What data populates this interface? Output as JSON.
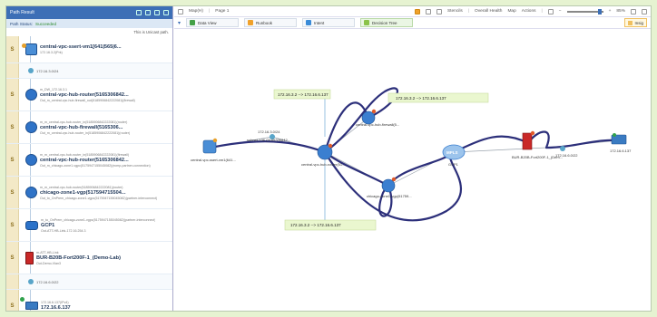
{
  "left_panel": {
    "title": "Path Result",
    "status_label": "Path Status:",
    "status_value": "Succeeded",
    "note": "This is Unicast path.",
    "hops": [
      {
        "index": "S",
        "kind": "device",
        "icon": "vpc-icon",
        "top": "",
        "name": "central-vpc-ssert-vm1[641|565|6...",
        "sub": "172.16.3.2(Prk)"
      },
      {
        "index": "",
        "kind": "link",
        "iface": "172.16.3.0/24"
      },
      {
        "index": "S",
        "kind": "device",
        "icon": "router-icon",
        "top": "m_DW_172.16.3.1",
        "name": "central-vpc-hub-router(5165306842...",
        "sub": "Out_m_central-vpc-hub-firewall_out(5185906842222081)(firewall)"
      },
      {
        "index": "S",
        "kind": "device",
        "icon": "router-icon",
        "top": "m_m_central-vpc-hub-router_in(5185906842222081)(router)",
        "name": "central-vpc-hub-firewall(5165306...",
        "sub": "Out_m_central-vpc-hub-router_in(5185906842222081)(router)"
      },
      {
        "index": "S",
        "kind": "device",
        "icon": "router-icon",
        "top": "m_m_central-vpc-hub-router_in(5185906842222081)(firewall)",
        "name": "central-vpc-hub-router(5165306842...",
        "sub": "Out_m_chicago-zone1-vgpc(5175947155045082)(ecmp-partner-connection)"
      },
      {
        "index": "S",
        "kind": "device",
        "icon": "router-icon",
        "top": "m_m_central-vpc-hub-router(5185906842222081)(router)",
        "name": "chicago-zone1-vgp(517594715504...",
        "sub": "Out_to_OnPrem_chicago-zone1-vgpc(5175947155045082)(partner-interconnect)"
      },
      {
        "index": "S",
        "kind": "device",
        "icon": "gcp-icon",
        "top": "m_to_OnPrem_chicago-zone1-vgpc(5175947155045082)(partner-interconnect)",
        "name": "GCP1",
        "sub": "Out-ATT-HB-Link-172.16.254.3"
      },
      {
        "index": "S",
        "kind": "device",
        "icon": "firewall-icon",
        "top": "m-ATT-HB-Link",
        "name": "BUR-B20B-Fort200F-1_(Demo-Lab)",
        "sub": "Out-Demo-Vlan3"
      },
      {
        "index": "",
        "kind": "link",
        "iface": "172.16.6.0/22"
      },
      {
        "index": "S",
        "kind": "device",
        "icon": "host-icon",
        "top": "172.16.6.137(IPv4)",
        "name": "172.16.6.137",
        "sub": ""
      }
    ]
  },
  "toolbar": {
    "map_label": "Map(H)",
    "page_label": "Page 1",
    "stencils": "Stencils",
    "overall_health": "Overall Health",
    "map": "Map",
    "actions": "Actions",
    "zoom": "85%"
  },
  "tabs": [
    {
      "label": "Data View",
      "color": "#43a047"
    },
    {
      "label": "Runbook",
      "color": "#f0a12a"
    },
    {
      "label": "Intent",
      "color": "#3a8bd8"
    },
    {
      "label": "Decision Tree",
      "color": "#8bc34a"
    }
  ],
  "insight_label": "Insig",
  "map_nodes": [
    {
      "label": "central-vpc-ssert-vm1(641...",
      "icon": "vpc-icon"
    },
    {
      "label": "central-vpc-hub-router(51...",
      "icon": "router-icon"
    },
    {
      "label": "central-vpc-hub-firewall(5...",
      "icon": "router-icon"
    },
    {
      "label": "chicago-zone1-vgp(51759...",
      "icon": "router-icon"
    },
    {
      "label": "GCP1",
      "icon": "mpls-icon"
    },
    {
      "label": "BUR-B20B-Fort200F-1_(Dem...",
      "icon": "firewall-icon"
    },
    {
      "label": "172.16.6.137",
      "icon": "host-icon"
    }
  ],
  "link_labels": {
    "left": "172.16.3.0/24",
    "left_sub": "subnet-136 (5165306842...",
    "right": "172.16.6.0/22"
  },
  "notes": [
    "172.16.3.2 --> 172.16.6.137",
    "172.16.3.2 --> 172.16.6.137",
    "172.16.3.2 --> 172.16.6.137"
  ],
  "colors": {
    "header": "#3d6fb6",
    "path_line": "#2c2f7a",
    "note_bg": "#eaf7cf",
    "background": "#e6f3d1"
  }
}
